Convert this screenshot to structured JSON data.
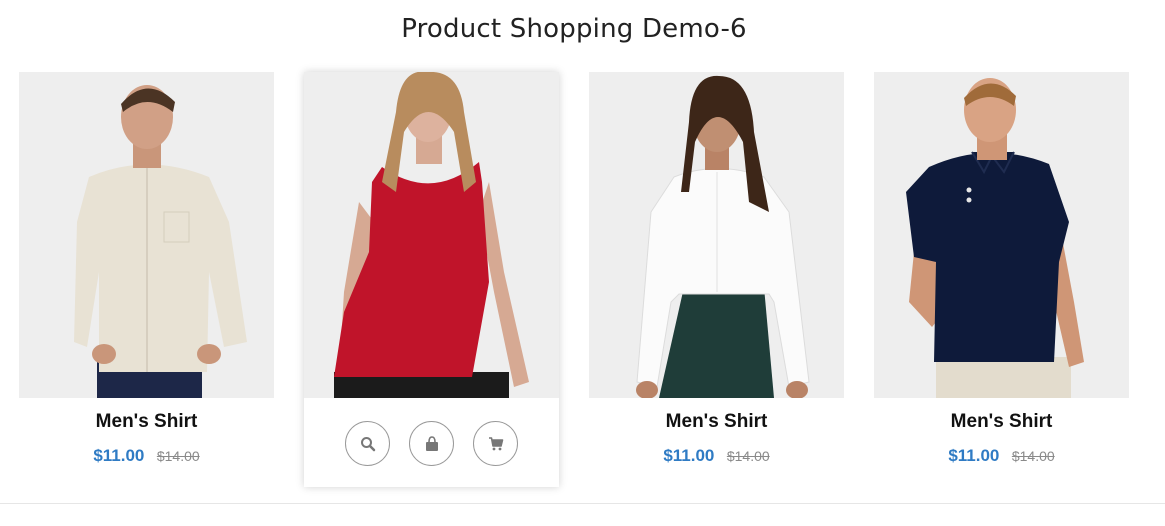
{
  "page": {
    "title": "Product Shopping Demo-6"
  },
  "products": [
    {
      "name": "Men's Shirt",
      "price": "$11.00",
      "old_price": "$14.00",
      "image": "man-linen-shirt"
    },
    {
      "name": "",
      "price": "",
      "old_price": "",
      "image": "woman-red-top",
      "hover": true
    },
    {
      "name": "Men's Shirt",
      "price": "$11.00",
      "old_price": "$14.00",
      "image": "woman-white-shirt"
    },
    {
      "name": "Men's Shirt",
      "price": "$11.00",
      "old_price": "$14.00",
      "image": "man-navy-polo"
    }
  ],
  "actions": [
    {
      "icon": "search-icon"
    },
    {
      "icon": "bag-icon"
    },
    {
      "icon": "cart-icon"
    }
  ],
  "colors": {
    "price": "#2f7bc4",
    "old_price": "#8a8a8a",
    "photo_bg": "#eeeeee"
  }
}
